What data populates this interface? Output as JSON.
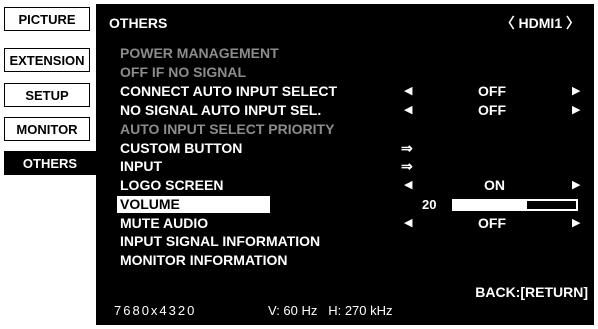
{
  "tabs": [
    {
      "label": "PICTURE"
    },
    {
      "label": "EXTENSION"
    },
    {
      "label": "SETUP"
    },
    {
      "label": "MONITOR"
    },
    {
      "label": "OTHERS",
      "active": true
    }
  ],
  "header": {
    "title": "OTHERS",
    "input": "〈 HDMI1 〉"
  },
  "menu": {
    "power_management": "POWER MANAGEMENT",
    "off_if_no_signal": "OFF IF NO SIGNAL",
    "connect_auto_input": {
      "label": "CONNECT AUTO INPUT SELECT",
      "value": "OFF"
    },
    "no_signal_auto_input": {
      "label": "NO SIGNAL AUTO INPUT SEL.",
      "value": "OFF"
    },
    "auto_input_priority": "AUTO INPUT SELECT PRIORITY",
    "custom_button": "CUSTOM BUTTON",
    "input": "INPUT",
    "logo_screen": {
      "label": "LOGO SCREEN",
      "value": "ON"
    },
    "volume": {
      "label": "VOLUME",
      "value": "20",
      "level_fraction": 0.6
    },
    "mute_audio": {
      "label": "MUTE AUDIO",
      "value": "OFF"
    },
    "input_signal_info": "INPUT SIGNAL INFORMATION",
    "monitor_info": "MONITOR INFORMATION"
  },
  "footer": {
    "back": "BACK:[RETURN]",
    "resolution": "7680x4320",
    "frequency": "V: 60 Hz   H: 270 kHz"
  },
  "glyphs": {
    "left": "◀",
    "right": "▶",
    "enter": "⇒"
  }
}
